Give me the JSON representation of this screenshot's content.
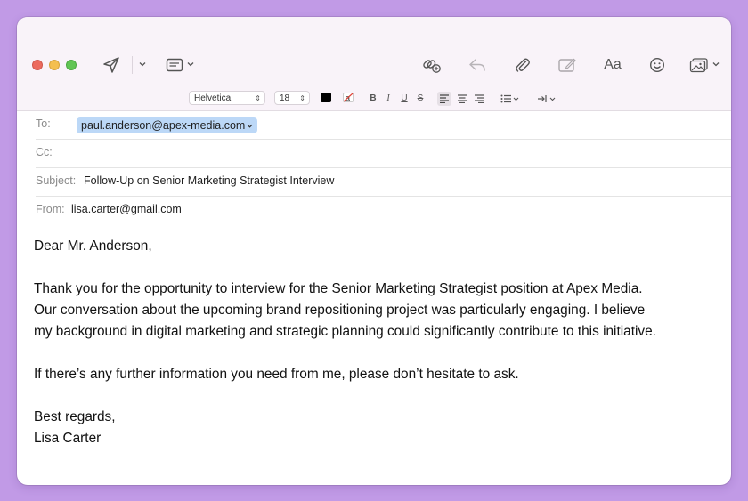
{
  "toolbar": {
    "icons": [
      "send-icon",
      "header-fields-icon",
      "link-icon",
      "reply-icon",
      "attachment-icon",
      "markup-icon",
      "fonts-icon",
      "emoji-icon",
      "photo-browser-icon"
    ],
    "fonts_label": "Aa"
  },
  "format": {
    "font": "Helvetica",
    "size": "18",
    "text_color": "#000000",
    "bold": "B",
    "italic": "I",
    "underline": "U",
    "strike": "S"
  },
  "header": {
    "to_label": "To:",
    "to_value": "paul.anderson@apex-media.com",
    "cc_label": "Cc:",
    "cc_value": "",
    "subject_label": "Subject:",
    "subject_value": "Follow-Up on Senior Marketing Strategist Interview",
    "from_label": "From:",
    "from_value": "lisa.carter@gmail.com"
  },
  "body": {
    "greeting": "Dear Mr. Anderson,",
    "para1_line1": "Thank you for the opportunity to interview for the Senior Marketing Strategist position at Apex Media.",
    "para1_line2": "Our conversation about the upcoming brand repositioning project was particularly engaging. I believe",
    "para1_line3": "my background in digital marketing and strategic planning could significantly contribute to this initiative.",
    "para2": "If there’s any further information you need from me, please don’t hesitate to ask.",
    "closing": "Best regards,",
    "signature": "Lisa Carter"
  },
  "colors": {
    "background": "#c19ae6",
    "toolbar": "#f9f3f9",
    "token": "#bcd8f7",
    "close": "#ec6a5e",
    "minimize": "#f4bf4f",
    "zoom": "#61c554"
  }
}
